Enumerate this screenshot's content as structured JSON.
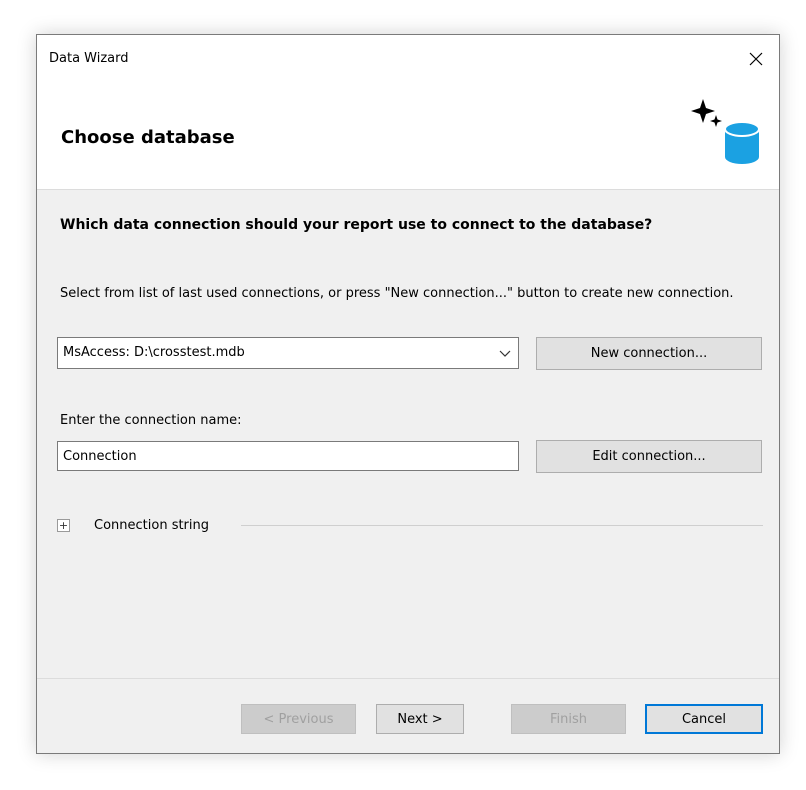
{
  "window": {
    "title": "Data Wizard"
  },
  "header": {
    "title": "Choose database"
  },
  "content": {
    "question": "Which data connection should your report use to connect to the database?",
    "hint": "Select from list of last used connections, or press \"New connection...\" button to create new connection.",
    "connection_select": {
      "value": "MsAccess: D:\\crosstest.mdb"
    },
    "new_connection_label": "New connection...",
    "name_label": "Enter the connection name:",
    "name_input_value": "Connection",
    "edit_connection_label": "Edit connection...",
    "connection_string_label": "Connection string",
    "expander_symbol": "+"
  },
  "footer": {
    "previous_label": "< Previous",
    "next_label": "Next >",
    "finish_label": "Finish",
    "cancel_label": "Cancel"
  },
  "icons": {
    "close": "close-icon",
    "database": "database-sparkle-icon",
    "dropdown": "chevron-down-icon"
  },
  "colors": {
    "accent": "#0078d7",
    "db_icon": "#1ba1e2"
  }
}
